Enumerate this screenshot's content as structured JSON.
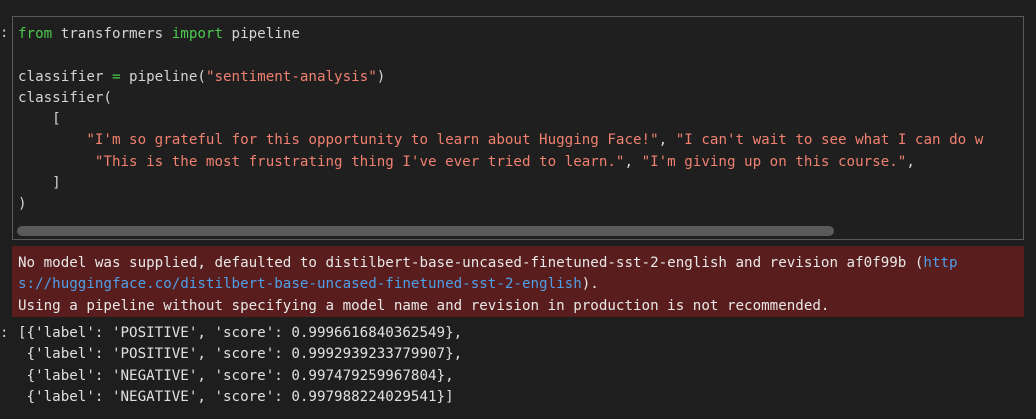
{
  "prompts": {
    "code": ":",
    "result": ":"
  },
  "code": {
    "line1": {
      "kw_from": "from",
      "mod": " transformers ",
      "kw_import": "import",
      "name": " pipeline"
    },
    "line3": {
      "var": "classifier ",
      "eq": "=",
      "call": " pipeline(",
      "arg": "\"sentiment-analysis\"",
      "close": ")"
    },
    "line4": "classifier(",
    "line5": "    [",
    "line6": {
      "indent": "        ",
      "s1": "\"I'm so grateful for this opportunity to learn about Hugging Face!\"",
      "sep": ", ",
      "s2": "\"I can't wait to see what I can do w"
    },
    "line7": {
      "indent": "         ",
      "s1": "\"This is the most frustrating thing I've ever tried to learn.\"",
      "sep": ", ",
      "s2": "\"I'm giving up on this course.\"",
      "end": ","
    },
    "line8": "    ]",
    "line9": ")"
  },
  "stderr": {
    "line1_text": "No model was supplied, defaulted to distilbert-base-uncased-finetuned-sst-2-english and revision af0f99b (",
    "line1_link": "http",
    "line2_link": "s://huggingface.co/distilbert-base-uncased-finetuned-sst-2-english",
    "line2_text": ").",
    "line3": "Using a pipeline without specifying a model name and revision in production is not recommended."
  },
  "result": [
    "[{'label': 'POSITIVE', 'score': 0.9996616840362549},",
    " {'label': 'POSITIVE', 'score': 0.9992939233779907},",
    " {'label': 'NEGATIVE', 'score': 0.997479259967804},",
    " {'label': 'NEGATIVE', 'score': 0.997988224029541}]"
  ]
}
